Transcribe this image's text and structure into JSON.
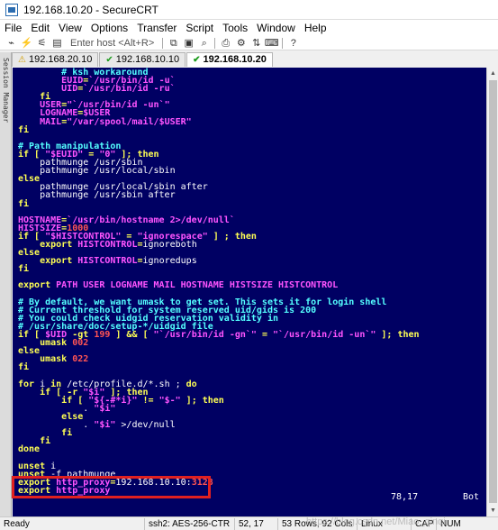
{
  "window": {
    "title": "192.168.10.20 - SecureCRT"
  },
  "menu": [
    "File",
    "Edit",
    "View",
    "Options",
    "Transfer",
    "Script",
    "Tools",
    "Window",
    "Help"
  ],
  "toolbar": {
    "quick_connect_placeholder": "Enter host <Alt+R>",
    "icons": [
      "connect-icon",
      "reconnect-icon",
      "disconnect-icon",
      "copy-icon",
      "paste-icon",
      "find-icon",
      "print-icon",
      "settings-icon",
      "sftp-icon",
      "keymap-icon",
      "help-icon"
    ]
  },
  "session_manager": {
    "label": "Session Manager"
  },
  "tabs": [
    {
      "label": "192.168.20.10",
      "status": "warning",
      "active": false
    },
    {
      "label": "192.168.10.10",
      "status": "connected",
      "active": false
    },
    {
      "label": "192.168.10.20",
      "status": "connected",
      "active": true
    }
  ],
  "terminal": {
    "colors": {
      "background": "#000063",
      "keyword": "#ffff54",
      "variable": "#ff54ff",
      "comment": "#54ffff",
      "text": "#ffffff",
      "number": "#ff5454"
    },
    "lines": [
      [
        [
          "c",
          "        # ksh workaround"
        ]
      ],
      [
        [
          "w",
          "        "
        ],
        [
          "m",
          "EUID"
        ],
        [
          "k",
          "="
        ],
        [
          "m",
          "`/usr/bin/id -u`"
        ]
      ],
      [
        [
          "w",
          "        "
        ],
        [
          "m",
          "UID"
        ],
        [
          "k",
          "="
        ],
        [
          "m",
          "`/usr/bin/id -ru`"
        ]
      ],
      [
        [
          "w",
          "    "
        ],
        [
          "k",
          "fi"
        ]
      ],
      [
        [
          "w",
          "    "
        ],
        [
          "m",
          "USER"
        ],
        [
          "k",
          "="
        ],
        [
          "m",
          "\"`/usr/bin/id -un`\""
        ]
      ],
      [
        [
          "w",
          "    "
        ],
        [
          "m",
          "LOGNAME"
        ],
        [
          "k",
          "="
        ],
        [
          "m",
          "$USER"
        ]
      ],
      [
        [
          "w",
          "    "
        ],
        [
          "m",
          "MAIL"
        ],
        [
          "k",
          "="
        ],
        [
          "m",
          "\"/var/spool/mail/$USER\""
        ]
      ],
      [
        [
          "k",
          "fi"
        ]
      ],
      [
        [
          "w",
          ""
        ]
      ],
      [
        [
          "c",
          "# Path manipulation"
        ]
      ],
      [
        [
          "k",
          "if [ "
        ],
        [
          "m",
          "\"$EUID\""
        ],
        [
          "k",
          " = "
        ],
        [
          "m",
          "\"0\""
        ],
        [
          "k",
          " ]; then"
        ]
      ],
      [
        [
          "w",
          "    pathmunge /usr/sbin"
        ]
      ],
      [
        [
          "w",
          "    pathmunge /usr/local/sbin"
        ]
      ],
      [
        [
          "k",
          "else"
        ]
      ],
      [
        [
          "w",
          "    pathmunge /usr/local/sbin after"
        ]
      ],
      [
        [
          "w",
          "    pathmunge /usr/sbin after"
        ]
      ],
      [
        [
          "k",
          "fi"
        ]
      ],
      [
        [
          "w",
          ""
        ]
      ],
      [
        [
          "m",
          "HOSTNAME"
        ],
        [
          "k",
          "="
        ],
        [
          "m",
          "`/usr/bin/hostname 2>/dev/null`"
        ]
      ],
      [
        [
          "m",
          "HISTSIZE"
        ],
        [
          "k",
          "="
        ],
        [
          "r",
          "1000"
        ]
      ],
      [
        [
          "k",
          "if [ "
        ],
        [
          "m",
          "\"$HISTCONTROL\""
        ],
        [
          "k",
          " = "
        ],
        [
          "m",
          "\"ignorespace\""
        ],
        [
          "k",
          " ] ; then"
        ]
      ],
      [
        [
          "w",
          "    "
        ],
        [
          "k",
          "export "
        ],
        [
          "m",
          "HISTCONTROL"
        ],
        [
          "k",
          "="
        ],
        [
          "w",
          "ignoreboth"
        ]
      ],
      [
        [
          "k",
          "else"
        ]
      ],
      [
        [
          "w",
          "    "
        ],
        [
          "k",
          "export "
        ],
        [
          "m",
          "HISTCONTROL"
        ],
        [
          "k",
          "="
        ],
        [
          "w",
          "ignoredups"
        ]
      ],
      [
        [
          "k",
          "fi"
        ]
      ],
      [
        [
          "w",
          ""
        ]
      ],
      [
        [
          "k",
          "export "
        ],
        [
          "m",
          "PATH USER LOGNAME MAIL HOSTNAME HISTSIZE HISTCONTROL"
        ]
      ],
      [
        [
          "w",
          ""
        ]
      ],
      [
        [
          "c",
          "# By default, we want umask to get set. This sets it for login shell"
        ]
      ],
      [
        [
          "c",
          "# Current threshold for system reserved uid/gids is 200"
        ]
      ],
      [
        [
          "c",
          "# You could check uidgid reservation validity in"
        ]
      ],
      [
        [
          "c",
          "# /usr/share/doc/setup-*/uidgid file"
        ]
      ],
      [
        [
          "k",
          "if [ "
        ],
        [
          "m",
          "$UID"
        ],
        [
          "k",
          " -gt "
        ],
        [
          "r",
          "199"
        ],
        [
          "k",
          " ] && [ "
        ],
        [
          "m",
          "\"`/usr/bin/id -gn`\""
        ],
        [
          "k",
          " = "
        ],
        [
          "m",
          "\"`/usr/bin/id -un`\""
        ],
        [
          "k",
          " ]; then"
        ]
      ],
      [
        [
          "w",
          "    "
        ],
        [
          "k",
          "umask "
        ],
        [
          "r",
          "002"
        ]
      ],
      [
        [
          "k",
          "else"
        ]
      ],
      [
        [
          "w",
          "    "
        ],
        [
          "k",
          "umask "
        ],
        [
          "r",
          "022"
        ]
      ],
      [
        [
          "k",
          "fi"
        ]
      ],
      [
        [
          "w",
          ""
        ]
      ],
      [
        [
          "k",
          "for "
        ],
        [
          "w",
          "i "
        ],
        [
          "k",
          "in "
        ],
        [
          "w",
          "/etc/profile.d/*.sh ; "
        ],
        [
          "k",
          "do"
        ]
      ],
      [
        [
          "w",
          "    "
        ],
        [
          "k",
          "if [ -r "
        ],
        [
          "m",
          "\"$i\""
        ],
        [
          "k",
          " ]; then"
        ]
      ],
      [
        [
          "w",
          "        "
        ],
        [
          "k",
          "if [ "
        ],
        [
          "m",
          "\"${-#*i}\""
        ],
        [
          "k",
          " != "
        ],
        [
          "m",
          "\"$-\""
        ],
        [
          "k",
          " ]; then"
        ]
      ],
      [
        [
          "w",
          "            . "
        ],
        [
          "m",
          "\"$i\""
        ]
      ],
      [
        [
          "w",
          "        "
        ],
        [
          "k",
          "else"
        ]
      ],
      [
        [
          "w",
          "            . "
        ],
        [
          "m",
          "\"$i\""
        ],
        [
          "w",
          " >/dev/null"
        ]
      ],
      [
        [
          "w",
          "        "
        ],
        [
          "k",
          "fi"
        ]
      ],
      [
        [
          "w",
          "    "
        ],
        [
          "k",
          "fi"
        ]
      ],
      [
        [
          "k",
          "done"
        ]
      ],
      [
        [
          "w",
          ""
        ]
      ],
      [
        [
          "k",
          "unset "
        ],
        [
          "w",
          "i"
        ]
      ],
      [
        [
          "k",
          "unset "
        ],
        [
          "w",
          "-f pathmunge"
        ]
      ],
      [
        [
          "k",
          "export "
        ],
        [
          "m",
          "http_proxy"
        ],
        [
          "k",
          "="
        ],
        [
          "w",
          "192.168.10.10:"
        ],
        [
          "r",
          "3128"
        ]
      ],
      [
        [
          "k",
          "export "
        ],
        [
          "m",
          "http_proxy"
        ]
      ]
    ],
    "position_left": "78,17",
    "position_right": "Bot"
  },
  "statusbar": {
    "ready": "Ready",
    "ssh": "ssh2: AES-256-CTR",
    "cursor": "52, 17",
    "size": "53 Rows, 92 Cols",
    "os": "Linux",
    "cap": "CAP",
    "num": "NUM"
  },
  "watermark": "https://blog.csdn.net/Miao_qinqi"
}
